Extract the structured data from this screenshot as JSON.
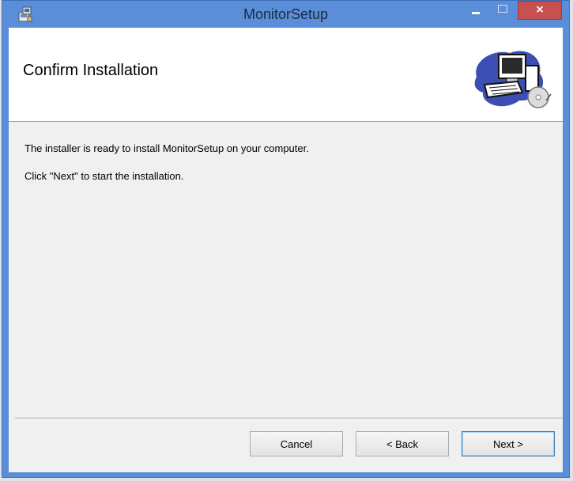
{
  "window": {
    "title": "MonitorSetup",
    "close_glyph": "×"
  },
  "header": {
    "title": "Confirm Installation",
    "art_icon": "computer-cd-icon"
  },
  "body": {
    "line1": "The installer is ready to install MonitorSetup on your computer.",
    "line2": "Click \"Next\" to start the installation."
  },
  "buttons": {
    "cancel": "Cancel",
    "back": "< Back",
    "next": "Next >"
  },
  "colors": {
    "titlebar": "#5b8ed8",
    "close": "#c75050",
    "client": "#f0f0f0"
  }
}
